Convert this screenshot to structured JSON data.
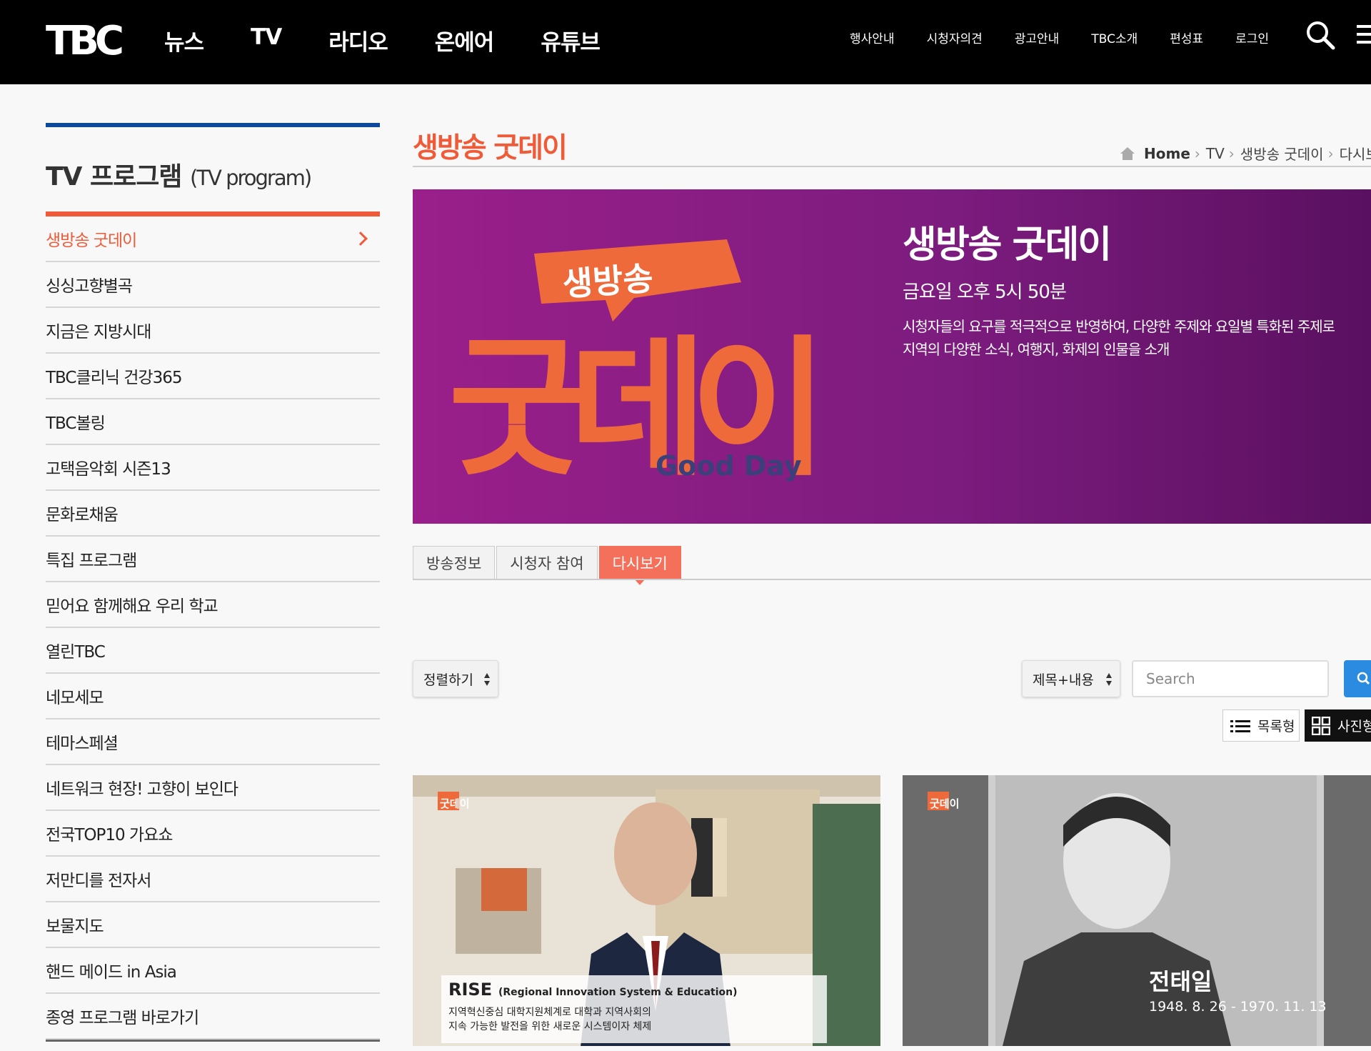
{
  "header": {
    "logo_text": "TBC",
    "main_nav": [
      "뉴스",
      "TV",
      "라디오",
      "온에어",
      "유튜브"
    ],
    "util_nav": [
      "행사안내",
      "시청자의견",
      "광고안내",
      "TBC소개",
      "편성표",
      "로그인"
    ]
  },
  "sidebar": {
    "title": "TV 프로그램",
    "subtitle": "(TV program)",
    "items": [
      {
        "label": "생방송 굿데이",
        "active": true
      },
      {
        "label": "싱싱고향별곡"
      },
      {
        "label": "지금은 지방시대"
      },
      {
        "label": "TBC클리닉 건강365"
      },
      {
        "label": "TBC볼링"
      },
      {
        "label": "고택음악회 시즌13"
      },
      {
        "label": "문화로채움"
      },
      {
        "label": "특집 프로그램"
      },
      {
        "label": "믿어요 함께해요 우리 학교"
      },
      {
        "label": "열린TBC"
      },
      {
        "label": "네모세모"
      },
      {
        "label": "테마스페셜"
      },
      {
        "label": "네트워크 현장! 고향이 보인다"
      },
      {
        "label": "전국TOP10 가요쇼"
      },
      {
        "label": "저만디를 전자서"
      },
      {
        "label": "보물지도"
      },
      {
        "label": "핸드 메이드 in Asia"
      },
      {
        "label": "종영 프로그램 바로가기"
      }
    ]
  },
  "page": {
    "title": "생방송 굿데이",
    "breadcrumb": [
      "Home",
      "TV",
      "생방송 굿데이",
      "다시보기"
    ]
  },
  "banner": {
    "logo_badge": "생방송",
    "logo_main": "굿데이",
    "logo_sub": "Good Day",
    "name": "생방송 굿데이",
    "schedule": "금요일 오후 5시 50분",
    "description": "시청자들의 요구를 적극적으로 반영하여, 다양한 주제와 요일별 특화된 주제로 지역의 다양한 소식, 여행지, 화제의 인물을 소개",
    "colors": {
      "background": "#8a1e86",
      "orange": "#ef6a3a",
      "blue": "#1f5ca8"
    }
  },
  "tabs": [
    {
      "label": "방송정보"
    },
    {
      "label": "시청자 참여"
    },
    {
      "label": "다시보기",
      "active": true
    }
  ],
  "controls": {
    "sort_label": "정렬하기",
    "field_label": "제목+내용",
    "search_placeholder": "Search",
    "view_list_label": "목록형",
    "view_grid_label": "사진형"
  },
  "thumbnails": [
    {
      "program_badge": "굿데이",
      "caption_title": "RISE",
      "caption_title_sub": "(Regional Innovation System & Education)",
      "caption_line1": "지역혁신중심 대학지원체계로 대학과 지역사회의",
      "caption_line2": "지속 가능한 발전을 위한 새로운 시스템이자 체제"
    },
    {
      "program_badge": "굿데이",
      "caption_name": "전태일",
      "caption_dates": "1948. 8. 26 - 1970. 11. 13"
    }
  ],
  "colors": {
    "accent": "#ef5b38",
    "sidebar_top": "#0d4a9c",
    "tab_active": "#f4705a",
    "search_button": "#2a8be0"
  }
}
